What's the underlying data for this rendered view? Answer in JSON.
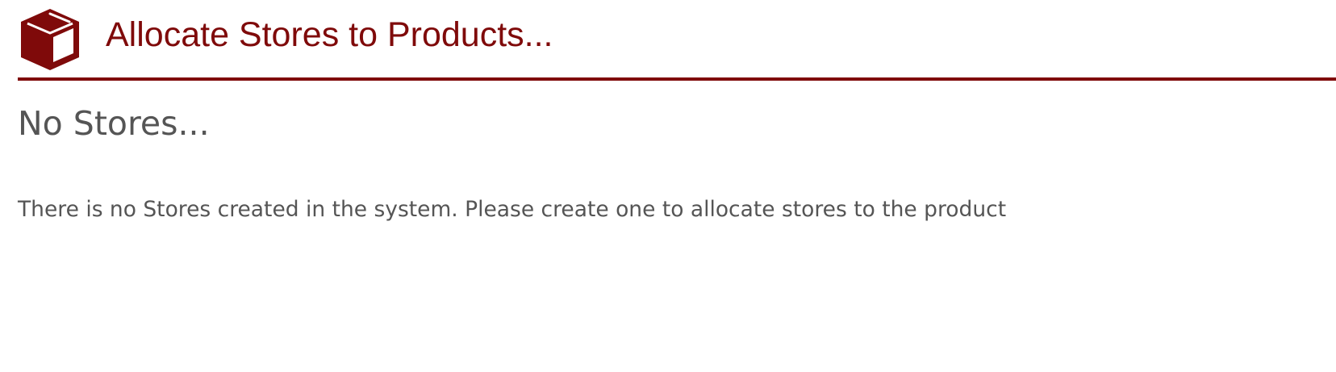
{
  "header": {
    "icon": "box-icon",
    "title": "Allocate Stores to Products..."
  },
  "main": {
    "section_title": "No Stores...",
    "message": "There is no Stores created in the system. Please create one to allocate stores to the product"
  },
  "colors": {
    "accent": "#7f0a0a",
    "text": "#555555",
    "background": "#ffffff"
  }
}
